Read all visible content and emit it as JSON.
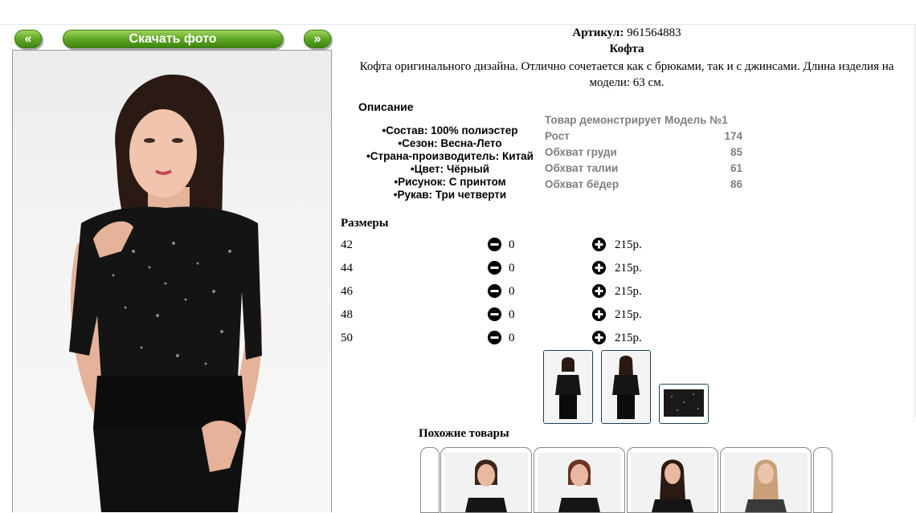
{
  "nav": {
    "prev_label": "«",
    "download_label": "Скачать фото",
    "next_label": "»"
  },
  "product": {
    "sku_label": "Артикул:",
    "sku_value": "961564883",
    "title": "Кофта",
    "description": "Кофта оригинального дизайна. Отлично сочетается как с брюками, так и с джинсами. Длина изделия на модели: 63 см."
  },
  "details": {
    "heading": "Описание",
    "items": [
      "Состав: 100% полиэстер",
      "Сезон: Весна-Лето",
      "Страна-производитель: Китай",
      "Цвет: Чёрный",
      "Рисунок: С принтом",
      "Рукав: Три четверти"
    ]
  },
  "model": {
    "heading": "Товар демонстрирует Модель №1",
    "rows": [
      {
        "label": "Рост",
        "value": "174"
      },
      {
        "label": "Обхват груди",
        "value": "85"
      },
      {
        "label": "Обхват талии",
        "value": "61"
      },
      {
        "label": "Обхват бёдер",
        "value": "86"
      }
    ]
  },
  "sizes": {
    "heading": "Размеры",
    "rows": [
      {
        "size": "42",
        "qty": "0",
        "price": "215р."
      },
      {
        "size": "44",
        "qty": "0",
        "price": "215р."
      },
      {
        "size": "46",
        "qty": "0",
        "price": "215р."
      },
      {
        "size": "48",
        "qty": "0",
        "price": "215р."
      },
      {
        "size": "50",
        "qty": "0",
        "price": "215р."
      }
    ]
  },
  "similar": {
    "heading": "Похожие товары"
  },
  "icons": {
    "minus": "minus-circle-icon",
    "plus": "plus-circle-icon"
  },
  "colors": {
    "button_green": "#5aa421",
    "thumb_border": "#1f3f5c",
    "model_text": "#7f7f7f"
  }
}
